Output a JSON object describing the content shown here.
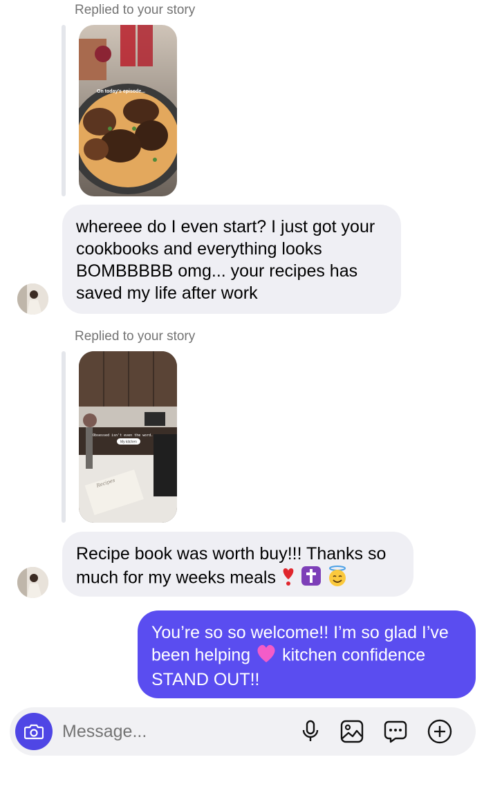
{
  "thread": {
    "story_reply_label_1": "Replied to your story",
    "story_1_caption": "On today's episode...",
    "message_1": "whereee do I even start? I just got your cookbooks and everything looks BOMBBBBB omg... your recipes has saved my life after work",
    "story_reply_label_2": "Replied to your story",
    "story_2_caption": "Obsessed isn't even the word.",
    "story_2_sticker": "My kitchen",
    "story_2_book_text": "Recipes",
    "message_2_text": "Recipe book was worth buy!!! Thanks so much for my weeks meals",
    "message_2_emojis": [
      "heart-exclamation",
      "latin-cross",
      "smiling-face-with-halo"
    ],
    "message_3_part_1": "You’re so so welcome!! I’m so glad I’ve been helping",
    "message_3_emoji": "pink-heart",
    "message_3_part_2": "kitchen confidence STAND OUT!!"
  },
  "composer": {
    "placeholder": "Message...",
    "icons": [
      "camera-icon",
      "microphone-icon",
      "gallery-icon",
      "sticker-icon",
      "add-icon"
    ]
  },
  "colors": {
    "my_bubble": "#5a4df0",
    "their_bubble": "#efeff4",
    "camera_button": "#4f46e5",
    "secondary_text": "#737373"
  }
}
